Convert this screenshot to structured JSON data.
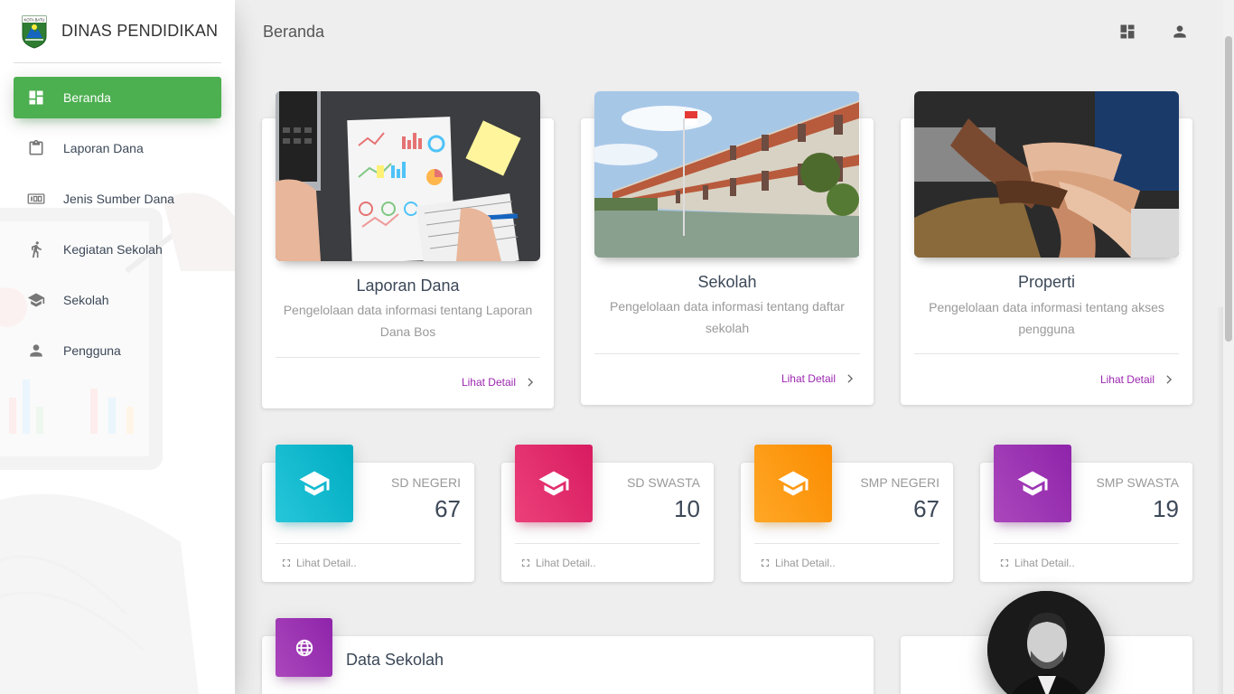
{
  "brand": {
    "name": "DINAS PENDIDIKAN",
    "logo_text": "KOTA BATU"
  },
  "sidebar": {
    "items": [
      {
        "label": "Beranda",
        "icon": "dashboard-icon",
        "active": true
      },
      {
        "label": "Laporan Dana",
        "icon": "clipboard-icon"
      },
      {
        "label": "Jenis Sumber Dana",
        "icon": "counter-100-icon"
      },
      {
        "label": "Kegiatan Sekolah",
        "icon": "running-person-icon"
      },
      {
        "label": "Sekolah",
        "icon": "school-icon"
      },
      {
        "label": "Pengguna",
        "icon": "person-icon"
      }
    ]
  },
  "topbar": {
    "title": "Beranda",
    "actions": [
      "dashboard-icon",
      "person-icon"
    ]
  },
  "cards": [
    {
      "title": "Laporan Dana",
      "description": "Pengelolaan data informasi tentang Laporan Dana Bos",
      "link": "Lihat Detail"
    },
    {
      "title": "Sekolah",
      "description": "Pengelolaan data informasi tentang daftar sekolah",
      "link": "Lihat Detail"
    },
    {
      "title": "Properti",
      "description": "Pengelolaan data informasi tentang akses pengguna",
      "link": "Lihat Detail"
    }
  ],
  "stats": [
    {
      "category": "SD NEGERI",
      "value": "67",
      "link": "Lihat Detail..",
      "color": "#00acc1"
    },
    {
      "category": "SD SWASTA",
      "value": "10",
      "link": "Lihat Detail..",
      "color": "#d81b60"
    },
    {
      "category": "SMP NEGERI",
      "value": "67",
      "link": "Lihat Detail..",
      "color": "#fb8c00"
    },
    {
      "category": "SMP SWASTA",
      "value": "19",
      "link": "Lihat Detail..",
      "color": "#8e24aa"
    }
  ],
  "data_sekolah": {
    "title": "Data Sekolah",
    "icon": "globe-icon"
  },
  "colors": {
    "active": "#4caf50",
    "link": "#9c27b0"
  }
}
